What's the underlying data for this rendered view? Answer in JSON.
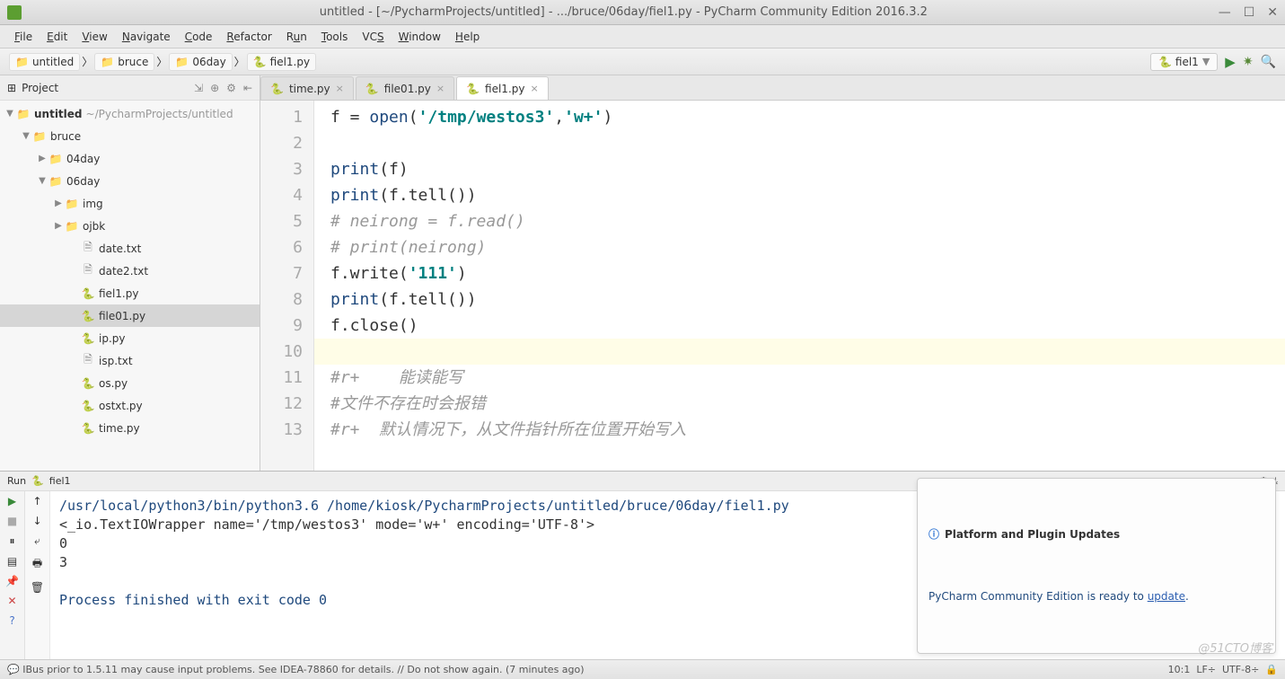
{
  "window": {
    "title": "untitled - [~/PycharmProjects/untitled] - .../bruce/06day/fiel1.py - PyCharm Community Edition 2016.3.2"
  },
  "menu": [
    "File",
    "Edit",
    "View",
    "Navigate",
    "Code",
    "Refactor",
    "Run",
    "Tools",
    "VCS",
    "Window",
    "Help"
  ],
  "breadcrumb": [
    "untitled",
    "bruce",
    "06day",
    "fiel1.py"
  ],
  "run_config": "fiel1",
  "sidebar": {
    "label": "Project",
    "root": {
      "name": "untitled",
      "path": "~/PycharmProjects/untitled"
    },
    "nodes": {
      "bruce": "bruce",
      "d04": "04day",
      "d06": "06day",
      "img": "img",
      "ojbk": "ojbk",
      "date": "date.txt",
      "date2": "date2.txt",
      "fiel1": "fiel1.py",
      "file01": "file01.py",
      "ip": "ip.py",
      "isp": "isp.txt",
      "os": "os.py",
      "ostxt": "ostxt.py",
      "time": "time.py"
    }
  },
  "tabs": [
    {
      "label": "time.py",
      "active": false
    },
    {
      "label": "file01.py",
      "active": false
    },
    {
      "label": "fiel1.py",
      "active": true
    }
  ],
  "code": {
    "l1_a": "f = ",
    "l1_b": "open",
    "l1_c": "(",
    "l1_d": "'/tmp/westos3'",
    "l1_e": ",",
    "l1_f": "'w+'",
    "l1_g": ")",
    "l3": "print",
    "l3b": "(f)",
    "l4": "print",
    "l4b": "(f.tell())",
    "l5": "# neirong = f.read()",
    "l6": "# print(neirong)",
    "l7a": "f.write(",
    "l7b": "'111'",
    "l7c": ")",
    "l8": "print",
    "l8b": "(f.tell())",
    "l9": "f.close()",
    "l11": "#r+    能读能写",
    "l12": "#文件不存在时会报错",
    "l13": "#r+  默认情况下，从文件指针所在位置开始写入"
  },
  "run": {
    "title_a": "Run",
    "title_b": "fiel1",
    "out_cmd": "/usr/local/python3/bin/python3.6 /home/kiosk/PycharmProjects/untitled/bruce/06day/fiel1.py",
    "out_l2": "<_io.TextIOWrapper name='/tmp/westos3' mode='w+' encoding='UTF-8'>",
    "out_l3": "0",
    "out_l4": "3",
    "out_done": "Process finished with exit code 0"
  },
  "popup": {
    "title": "Platform and Plugin Updates",
    "body_a": "PyCharm Community Edition is ready to ",
    "body_link": "update",
    "body_b": "."
  },
  "status": {
    "left": "IBus prior to 1.5.11 may cause input problems. See IDEA-78860 for details. // Do not show again. (7 minutes ago)",
    "pos": "10:1",
    "lf": "LF÷",
    "enc": "UTF-8÷",
    "lock": "🔒"
  },
  "watermark": "@51CTO博客"
}
